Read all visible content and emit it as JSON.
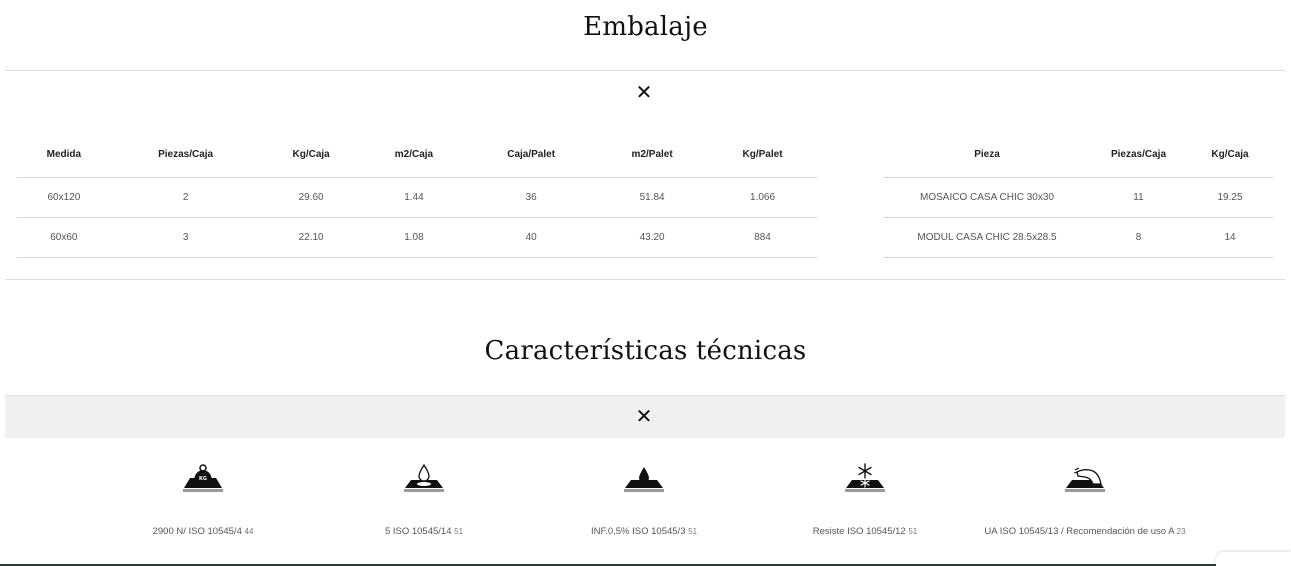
{
  "embalaje": {
    "title": "Embalaje",
    "close_symbol": "✕",
    "medidas_table": {
      "headers": [
        "Medida",
        "Piezas/Caja",
        "Kg/Caja",
        "m2/Caja",
        "Caja/Palet",
        "m2/Palet",
        "Kg/Palet"
      ],
      "rows": [
        [
          "60x120",
          "2",
          "29.60",
          "1.44",
          "36",
          "51.84",
          "1.066"
        ],
        [
          "60x60",
          "3",
          "22.10",
          "1.08",
          "40",
          "43.20",
          "884"
        ]
      ]
    },
    "piezas_table": {
      "headers": [
        "Pieza",
        "Piezas/Caja",
        "Kg/Caja"
      ],
      "rows": [
        [
          "MOSAICO CASA CHIC 30x30",
          "11",
          "19.25"
        ],
        [
          "MODUL CASA CHIC 28.5x28.5",
          "8",
          "14"
        ]
      ]
    }
  },
  "caracteristicas": {
    "title": "Características técnicas",
    "close_symbol": "✕",
    "features": [
      {
        "icon": "weight-kg-icon",
        "text": "2900 N/ ISO 10545/4",
        "sub": "44"
      },
      {
        "icon": "water-drop-stain-icon",
        "text": "5 ISO 10545/14",
        "sub": "51"
      },
      {
        "icon": "water-absorption-icon",
        "text": "INF.0,5% ISO 10545/3",
        "sub": "51"
      },
      {
        "icon": "snowflake-frost-icon",
        "text": "Resiste ISO 10545/12",
        "sub": "51"
      },
      {
        "icon": "hand-abrasion-icon",
        "text": "UA ISO 10545/13 / Recomendación de uso A",
        "sub": "23"
      }
    ]
  }
}
